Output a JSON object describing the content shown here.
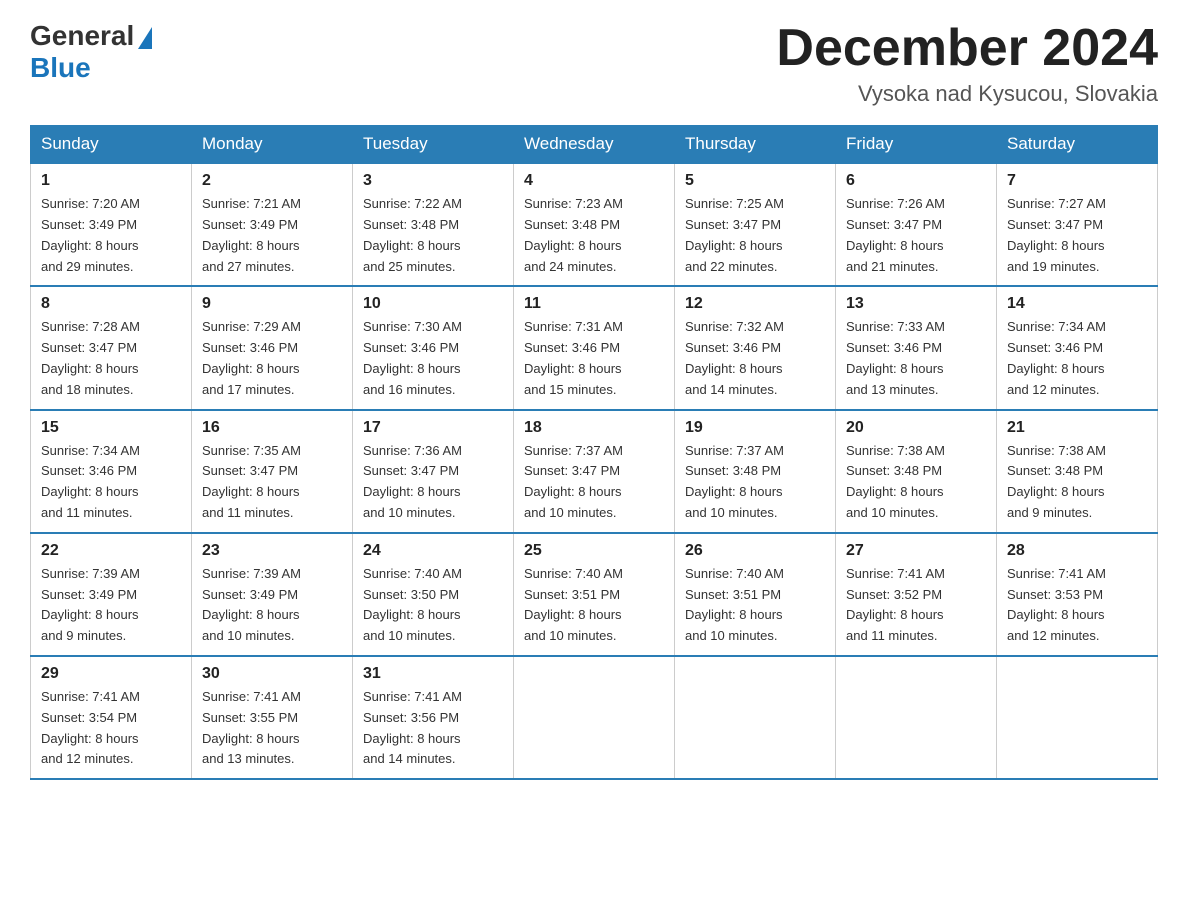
{
  "logo": {
    "general": "General",
    "blue": "Blue"
  },
  "header": {
    "month": "December 2024",
    "location": "Vysoka nad Kysucou, Slovakia"
  },
  "weekdays": [
    "Sunday",
    "Monday",
    "Tuesday",
    "Wednesday",
    "Thursday",
    "Friday",
    "Saturday"
  ],
  "weeks": [
    [
      {
        "day": "1",
        "sunrise": "7:20 AM",
        "sunset": "3:49 PM",
        "daylight": "8 hours and 29 minutes."
      },
      {
        "day": "2",
        "sunrise": "7:21 AM",
        "sunset": "3:49 PM",
        "daylight": "8 hours and 27 minutes."
      },
      {
        "day": "3",
        "sunrise": "7:22 AM",
        "sunset": "3:48 PM",
        "daylight": "8 hours and 25 minutes."
      },
      {
        "day": "4",
        "sunrise": "7:23 AM",
        "sunset": "3:48 PM",
        "daylight": "8 hours and 24 minutes."
      },
      {
        "day": "5",
        "sunrise": "7:25 AM",
        "sunset": "3:47 PM",
        "daylight": "8 hours and 22 minutes."
      },
      {
        "day": "6",
        "sunrise": "7:26 AM",
        "sunset": "3:47 PM",
        "daylight": "8 hours and 21 minutes."
      },
      {
        "day": "7",
        "sunrise": "7:27 AM",
        "sunset": "3:47 PM",
        "daylight": "8 hours and 19 minutes."
      }
    ],
    [
      {
        "day": "8",
        "sunrise": "7:28 AM",
        "sunset": "3:47 PM",
        "daylight": "8 hours and 18 minutes."
      },
      {
        "day": "9",
        "sunrise": "7:29 AM",
        "sunset": "3:46 PM",
        "daylight": "8 hours and 17 minutes."
      },
      {
        "day": "10",
        "sunrise": "7:30 AM",
        "sunset": "3:46 PM",
        "daylight": "8 hours and 16 minutes."
      },
      {
        "day": "11",
        "sunrise": "7:31 AM",
        "sunset": "3:46 PM",
        "daylight": "8 hours and 15 minutes."
      },
      {
        "day": "12",
        "sunrise": "7:32 AM",
        "sunset": "3:46 PM",
        "daylight": "8 hours and 14 minutes."
      },
      {
        "day": "13",
        "sunrise": "7:33 AM",
        "sunset": "3:46 PM",
        "daylight": "8 hours and 13 minutes."
      },
      {
        "day": "14",
        "sunrise": "7:34 AM",
        "sunset": "3:46 PM",
        "daylight": "8 hours and 12 minutes."
      }
    ],
    [
      {
        "day": "15",
        "sunrise": "7:34 AM",
        "sunset": "3:46 PM",
        "daylight": "8 hours and 11 minutes."
      },
      {
        "day": "16",
        "sunrise": "7:35 AM",
        "sunset": "3:47 PM",
        "daylight": "8 hours and 11 minutes."
      },
      {
        "day": "17",
        "sunrise": "7:36 AM",
        "sunset": "3:47 PM",
        "daylight": "8 hours and 10 minutes."
      },
      {
        "day": "18",
        "sunrise": "7:37 AM",
        "sunset": "3:47 PM",
        "daylight": "8 hours and 10 minutes."
      },
      {
        "day": "19",
        "sunrise": "7:37 AM",
        "sunset": "3:48 PM",
        "daylight": "8 hours and 10 minutes."
      },
      {
        "day": "20",
        "sunrise": "7:38 AM",
        "sunset": "3:48 PM",
        "daylight": "8 hours and 10 minutes."
      },
      {
        "day": "21",
        "sunrise": "7:38 AM",
        "sunset": "3:48 PM",
        "daylight": "8 hours and 9 minutes."
      }
    ],
    [
      {
        "day": "22",
        "sunrise": "7:39 AM",
        "sunset": "3:49 PM",
        "daylight": "8 hours and 9 minutes."
      },
      {
        "day": "23",
        "sunrise": "7:39 AM",
        "sunset": "3:49 PM",
        "daylight": "8 hours and 10 minutes."
      },
      {
        "day": "24",
        "sunrise": "7:40 AM",
        "sunset": "3:50 PM",
        "daylight": "8 hours and 10 minutes."
      },
      {
        "day": "25",
        "sunrise": "7:40 AM",
        "sunset": "3:51 PM",
        "daylight": "8 hours and 10 minutes."
      },
      {
        "day": "26",
        "sunrise": "7:40 AM",
        "sunset": "3:51 PM",
        "daylight": "8 hours and 10 minutes."
      },
      {
        "day": "27",
        "sunrise": "7:41 AM",
        "sunset": "3:52 PM",
        "daylight": "8 hours and 11 minutes."
      },
      {
        "day": "28",
        "sunrise": "7:41 AM",
        "sunset": "3:53 PM",
        "daylight": "8 hours and 12 minutes."
      }
    ],
    [
      {
        "day": "29",
        "sunrise": "7:41 AM",
        "sunset": "3:54 PM",
        "daylight": "8 hours and 12 minutes."
      },
      {
        "day": "30",
        "sunrise": "7:41 AM",
        "sunset": "3:55 PM",
        "daylight": "8 hours and 13 minutes."
      },
      {
        "day": "31",
        "sunrise": "7:41 AM",
        "sunset": "3:56 PM",
        "daylight": "8 hours and 14 minutes."
      },
      null,
      null,
      null,
      null
    ]
  ]
}
